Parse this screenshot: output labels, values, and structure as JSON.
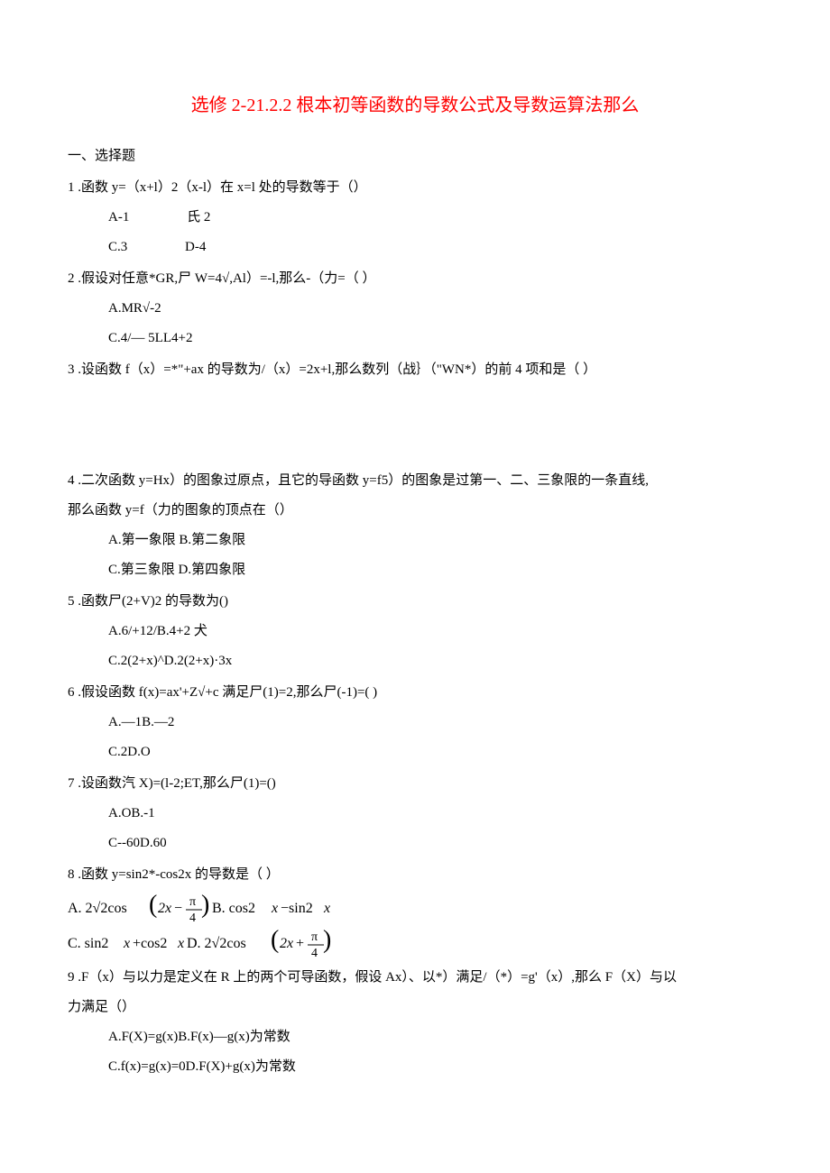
{
  "title": "选修 2-21.2.2 根本初等函数的导数公式及导数运算法那么",
  "section1": "一、选择题",
  "q1": {
    "stem": "1  .函数 y=（x+l）2（x-l）在 x=l 处的导数等于（）",
    "optA": "A-1",
    "optB": "氏 2",
    "optC": "C.3",
    "optD": "D-4"
  },
  "q2": {
    "stem": "2  .假设对任意*GR,尸 W=4√,Al）=-l,那么-（力=（                           ）",
    "optA": "A.MR√-2",
    "optC": "C.4/— 5LL4+2"
  },
  "q3": {
    "stem": "3  .设函数 f（x）=*\"+ax 的导数为/（x）=2x+l,那么数列（战｝（\"WN*）的前 4 项和是（        ）"
  },
  "q4": {
    "stem1": "4  .二次函数 y=Hx）的图象过原点，且它的导函数 y=f5）的图象是过第一、二、三象限的一条直线,",
    "stem2": "那么函数 y=f（力的图象的顶点在（）",
    "optA": "A.第一象限 B.第二象限",
    "optC": "C.第三象限 D.第四象限"
  },
  "q5": {
    "stem": "5  .函数尸(2+V)2 的导数为()",
    "optA": "A.6/+12/B.4+2 犬",
    "optC": "C.2(2+x)^D.2(2+x)·3x"
  },
  "q6": {
    "stem": "6  .假设函数 f(x)=ax'+Z√+c 满足尸(1)=2,那么尸(-1)=(                               )",
    "optA": "A.—1B.—2",
    "optC": "C.2D.O"
  },
  "q7": {
    "stem": "7  .设函数汽 X)=(l-2;ET,那么尸(1)=()",
    "optA": "A.OB.-1",
    "optC": "C--60D.60"
  },
  "q8": {
    "stem": "8  .函数 y=sin2*-cos2x 的导数是（        ）"
  },
  "q9": {
    "stem1": "9  .F（x）与以力是定义在 R 上的两个可导函数，假设 Ax）、以*）满足/（*）=g'（x）,那么 F（X）与以",
    "stem2": "力满足（）",
    "optA": "A.F(X)=g(x)B.F(x)—g(x)为常数",
    "optC": "C.f(x)=g(x)=0D.F(X)+g(x)为常数"
  }
}
